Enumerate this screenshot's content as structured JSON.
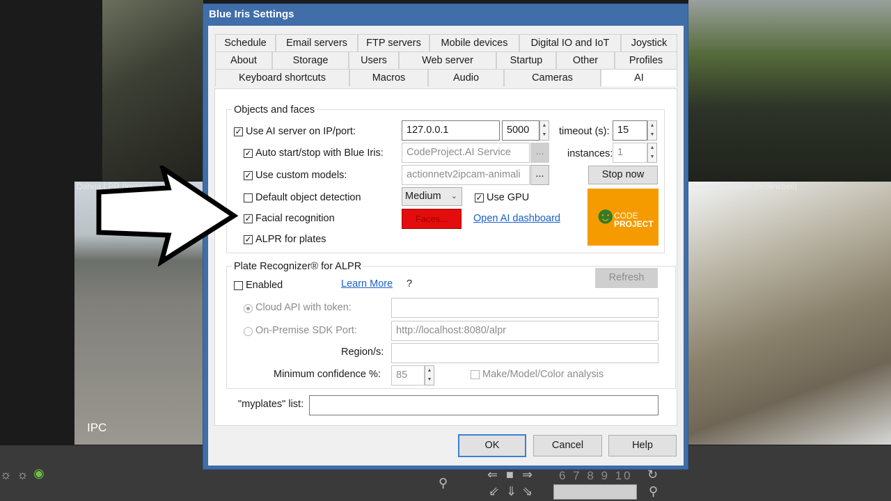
{
  "window": {
    "title": "Blue Iris Settings"
  },
  "cameras": {
    "lpr_label": "Dahua LPR (lprcam)",
    "doorbell_label": "Reolink Doorbell (reolinkbell)",
    "ipc_overlay": "IPC"
  },
  "tabs": {
    "row1": [
      "Schedule",
      "Email servers",
      "FTP servers",
      "Mobile devices",
      "Digital IO and IoT",
      "Joystick"
    ],
    "row2": [
      "About",
      "Storage",
      "Users",
      "Web server",
      "Startup",
      "Other",
      "Profiles"
    ],
    "row3": [
      "Keyboard shortcuts",
      "Macros",
      "Audio",
      "Cameras",
      "AI"
    ],
    "active": "AI"
  },
  "objects_faces": {
    "group_title": "Objects and faces",
    "use_ai_server": {
      "label": "Use AI server on IP/port:",
      "checked": true
    },
    "ip": "127.0.0.1",
    "port": "5000",
    "timeout_label": "timeout (s):",
    "timeout": "15",
    "auto_start": {
      "label": "Auto start/stop with Blue Iris:",
      "checked": true
    },
    "service": "CodeProject.AI Service",
    "instances_label": "instances:",
    "instances": "1",
    "custom_models": {
      "label": "Use custom models:",
      "checked": true
    },
    "models_value": "actionnetv2ipcam-animali",
    "browse_label": "...",
    "stop_now": "Stop now",
    "default_detection": {
      "label": "Default object detection",
      "checked": false
    },
    "detection_mode": "Medium",
    "use_gpu": {
      "label": "Use GPU",
      "checked": true
    },
    "facial": {
      "label": "Facial recognition",
      "checked": true
    },
    "faces_button": "Faces...",
    "dashboard_link": "Open AI dashboard",
    "alpr": {
      "label": "ALPR for plates",
      "checked": true
    },
    "logo_text": [
      "CODE",
      "PROJECT"
    ],
    "check_glyph": "✓"
  },
  "plate_recognizer": {
    "group_title": "Plate Recognizer® for ALPR",
    "enabled": {
      "label": "Enabled",
      "checked": false
    },
    "learn_more": "Learn More",
    "help_q": "?",
    "refresh": "Refresh",
    "cloud_api": "Cloud API with token:",
    "cloud_token": "",
    "on_premise": "On-Premise SDK Port:",
    "on_premise_url": "http://localhost:8080/alpr",
    "region_label": "Region/s:",
    "region_value": "",
    "min_conf_label": "Minimum confidence %:",
    "min_conf": "85",
    "make_model": {
      "label": "Make/Model/Color analysis",
      "checked": false
    }
  },
  "myplates": {
    "label": "\"myplates\" list:",
    "value": ""
  },
  "footer": {
    "ok": "OK",
    "cancel": "Cancel",
    "help": "Help"
  },
  "bottombar": {
    "numbers": "6 7 8 9 10"
  }
}
